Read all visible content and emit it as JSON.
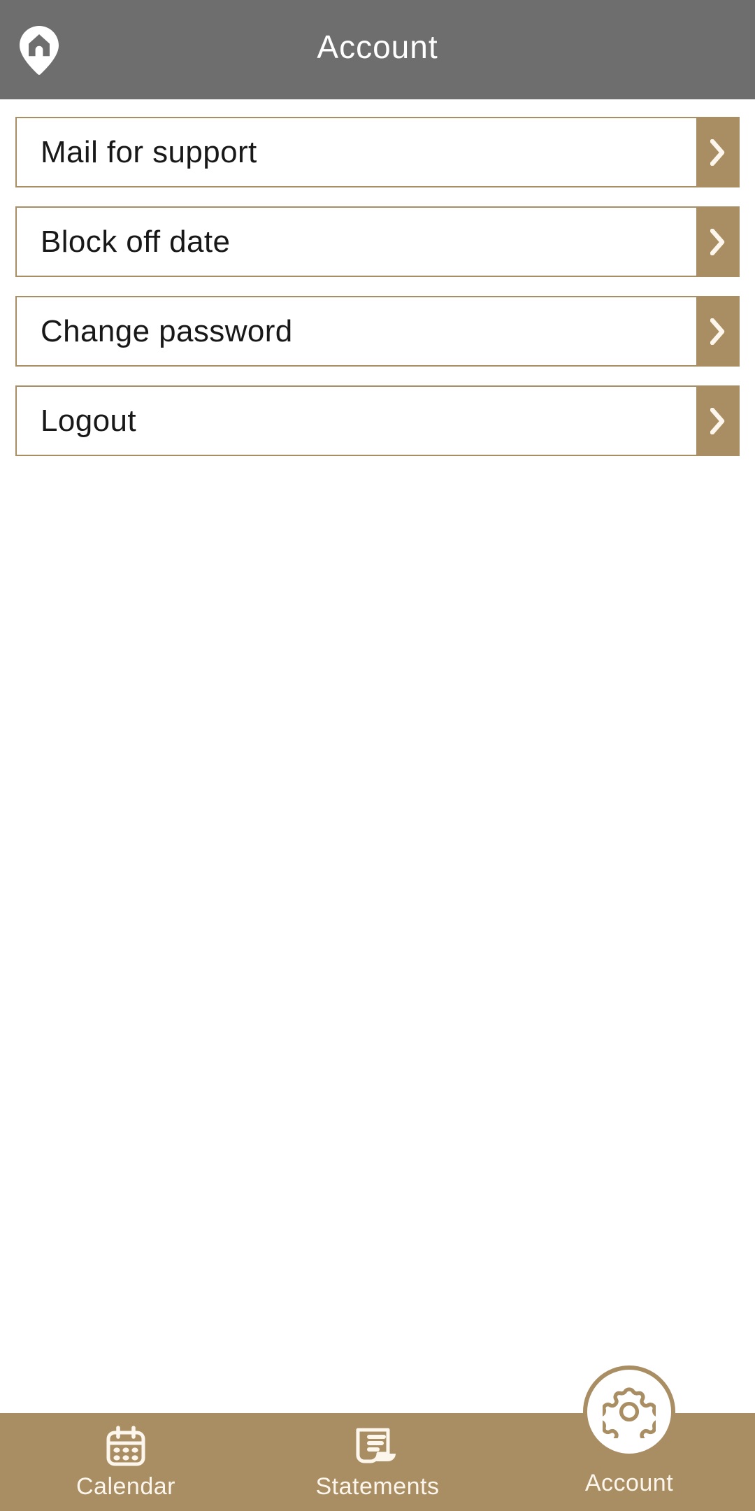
{
  "theme": {
    "header_bg": "#6e6e6e",
    "accent": "#a98d63",
    "page_bg": "#ffffff",
    "row_text": "#181818",
    "nav_label": "#fdf6ec"
  },
  "header": {
    "title": "Account",
    "home_icon": "home-pin-icon"
  },
  "menu": {
    "items": [
      {
        "label": "Mail for support",
        "arrow_icon": "chevron-right-icon"
      },
      {
        "label": "Block off date",
        "arrow_icon": "chevron-right-icon"
      },
      {
        "label": "Change password",
        "arrow_icon": "chevron-right-icon"
      },
      {
        "label": "Logout",
        "arrow_icon": "chevron-right-icon"
      }
    ]
  },
  "bottom_nav": {
    "items": [
      {
        "label": "Calendar",
        "icon": "calendar-icon",
        "active": false
      },
      {
        "label": "Statements",
        "icon": "receipt-icon",
        "active": false
      },
      {
        "label": "Account",
        "icon": "gear-icon",
        "active": true
      }
    ]
  }
}
